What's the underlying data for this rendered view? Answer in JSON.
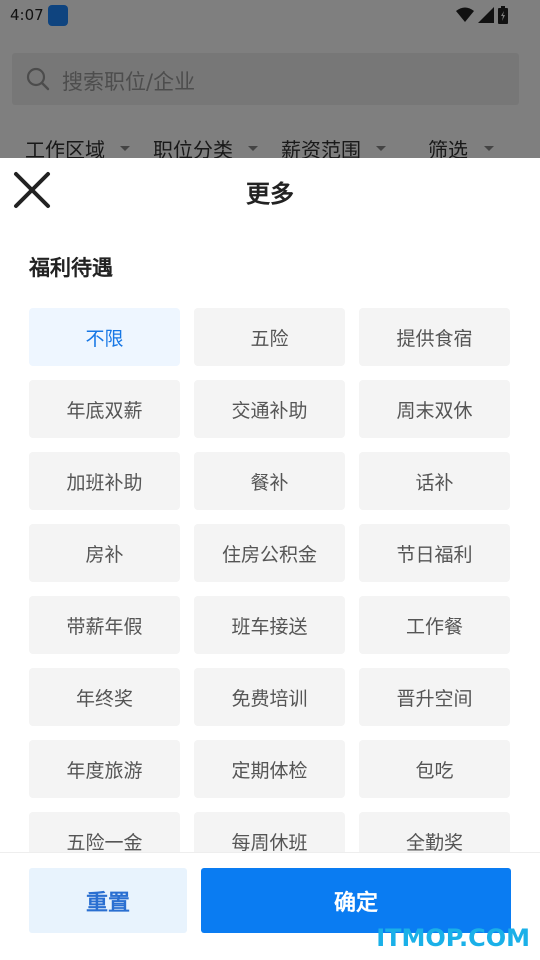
{
  "status_bar": {
    "time": "4:07"
  },
  "search": {
    "placeholder": "搜索职位/企业"
  },
  "filters": [
    {
      "label": "工作区域"
    },
    {
      "label": "职位分类"
    },
    {
      "label": "薪资范围"
    },
    {
      "label": "筛选"
    }
  ],
  "sheet": {
    "title": "更多",
    "section_title": "福利待遇",
    "options": [
      {
        "label": "不限",
        "selected": true
      },
      {
        "label": "五险"
      },
      {
        "label": "提供食宿"
      },
      {
        "label": "年底双薪"
      },
      {
        "label": "交通补助"
      },
      {
        "label": "周末双休"
      },
      {
        "label": "加班补助"
      },
      {
        "label": "餐补"
      },
      {
        "label": "话补"
      },
      {
        "label": "房补"
      },
      {
        "label": "住房公积金"
      },
      {
        "label": "节日福利"
      },
      {
        "label": "带薪年假"
      },
      {
        "label": "班车接送"
      },
      {
        "label": "工作餐"
      },
      {
        "label": "年终奖"
      },
      {
        "label": "免费培训"
      },
      {
        "label": "晋升空间"
      },
      {
        "label": "年度旅游"
      },
      {
        "label": "定期体检"
      },
      {
        "label": "包吃"
      },
      {
        "label": "五险一金"
      },
      {
        "label": "每周休班"
      },
      {
        "label": "全勤奖"
      }
    ],
    "reset_label": "重置",
    "confirm_label": "确定"
  },
  "watermark": "ITMOP.COM",
  "colors": {
    "accent": "#0a7cf2",
    "selected_bg": "#eef6ff",
    "selected_text": "#1677e5",
    "reset_bg": "#e8f3fd"
  }
}
